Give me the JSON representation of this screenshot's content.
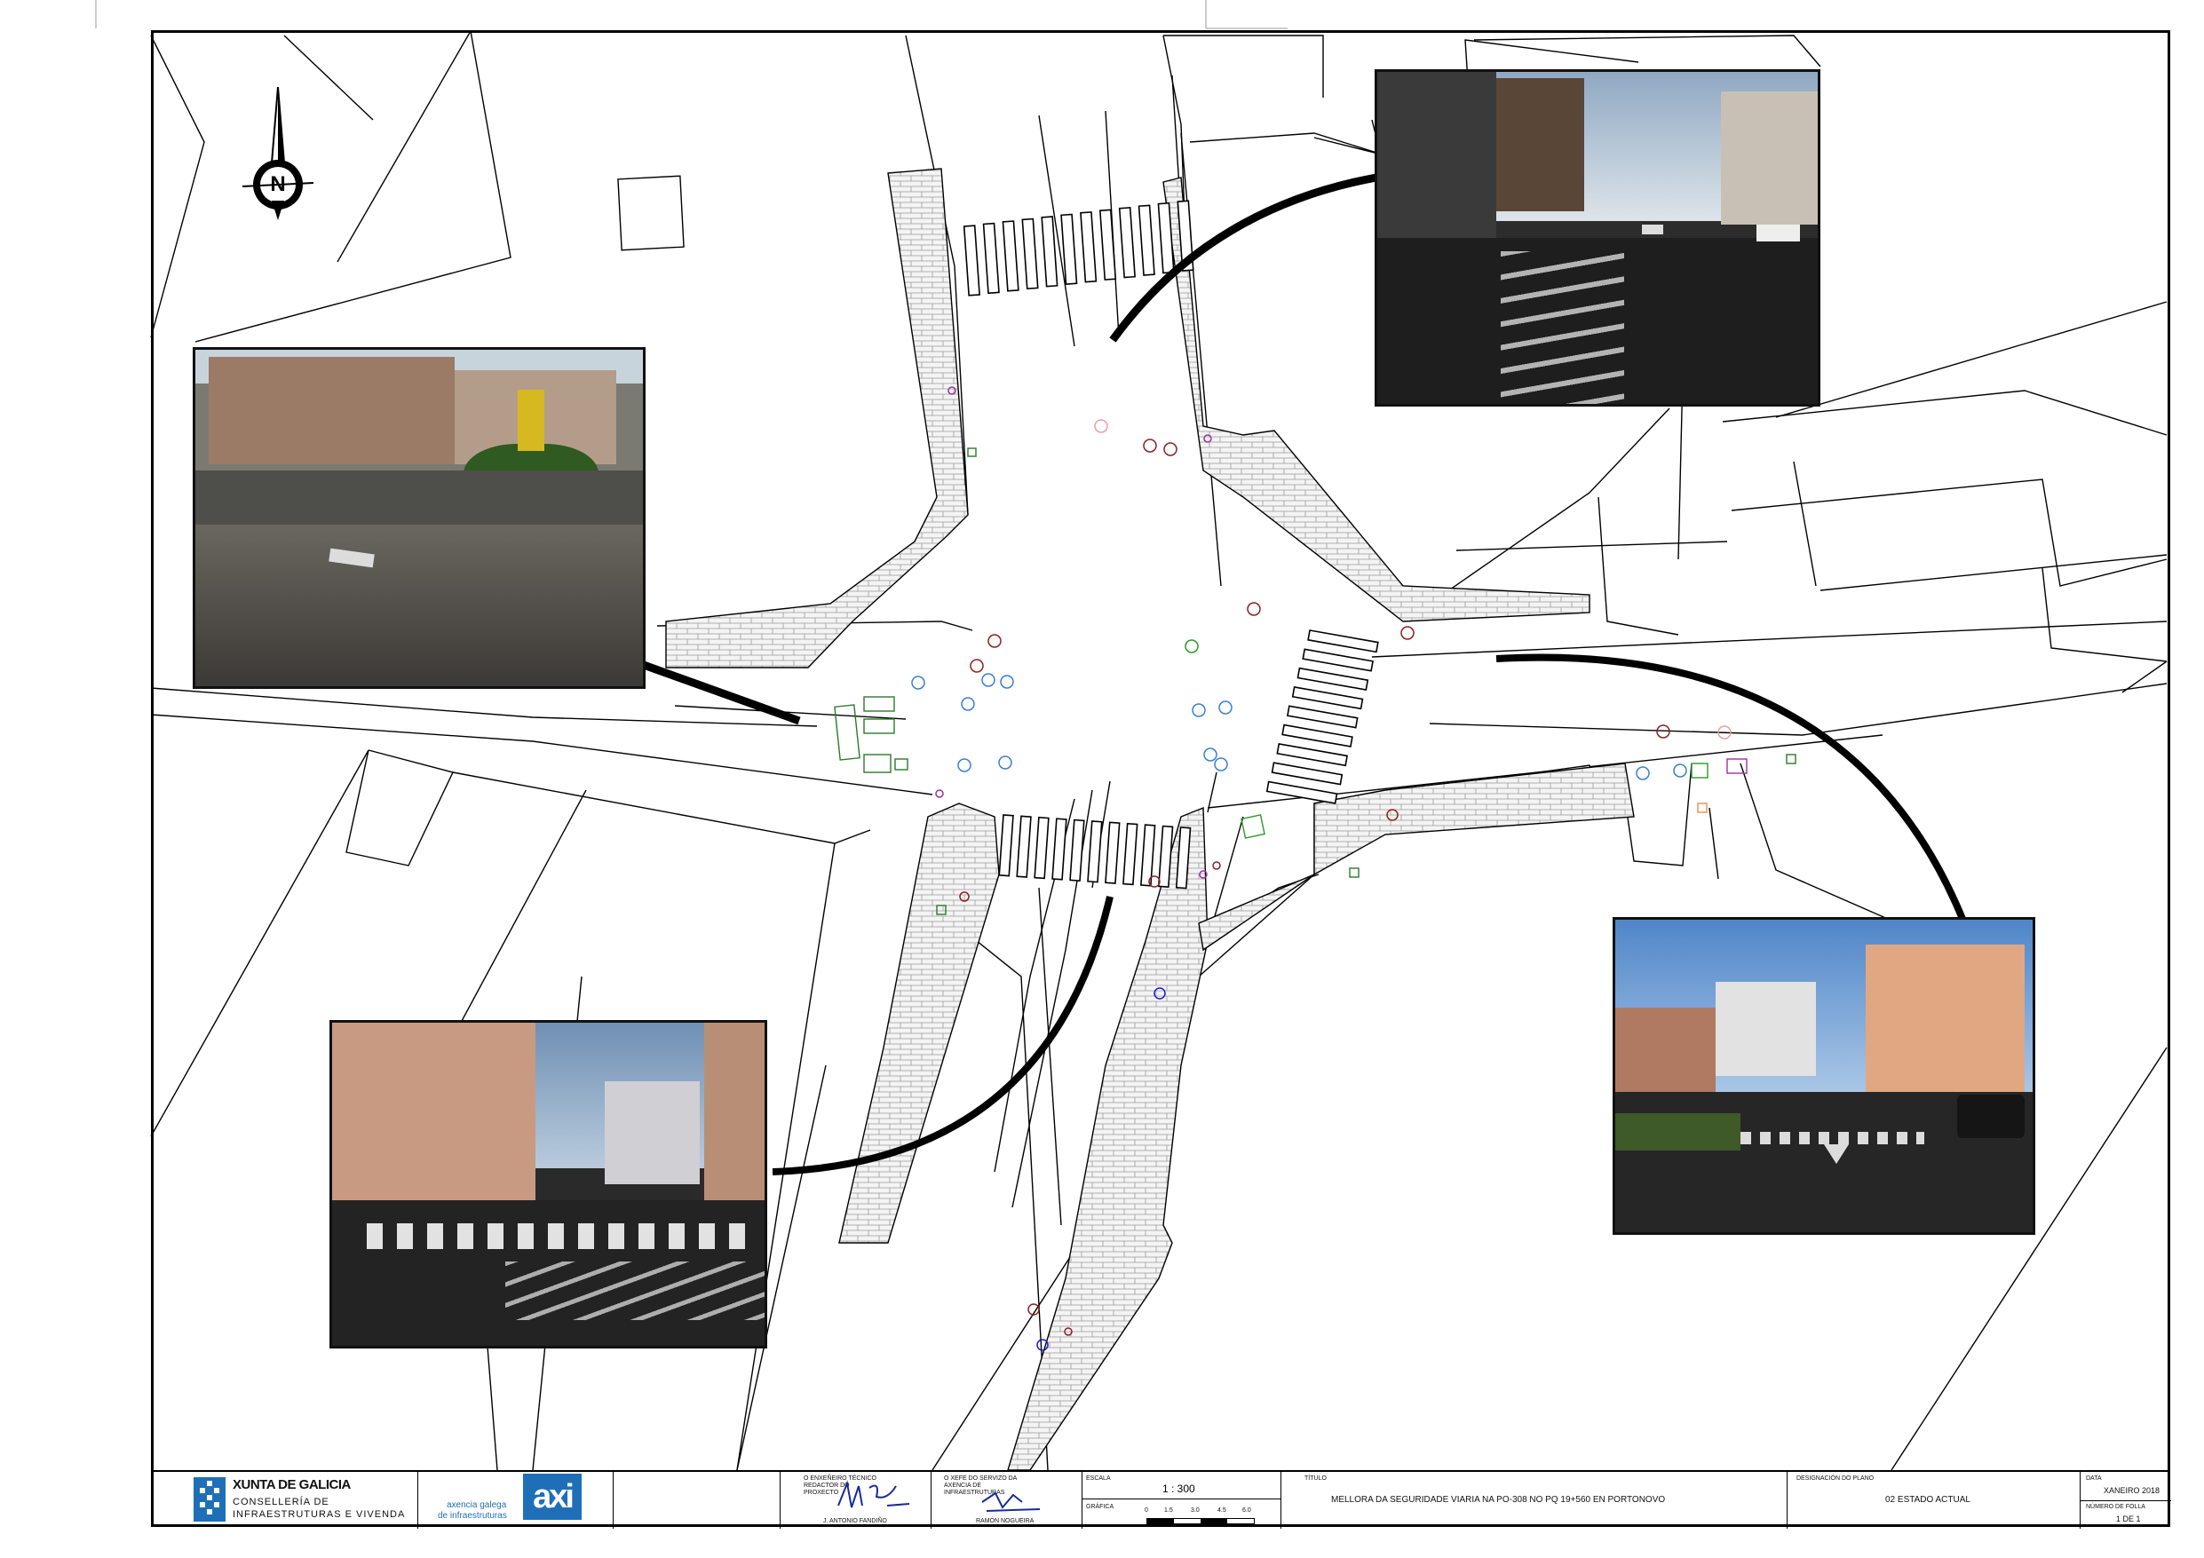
{
  "north_label": "N",
  "title_block": {
    "xunta_name": "XUNTA DE GALICIA",
    "consellaria_line1": "CONSELLERÍA DE",
    "consellaria_line2": "INFRAESTRUTURAS E VIVENDA",
    "axi_line1": "axencia galega",
    "axi_line2": "de infraestruturas",
    "axi_logo": "axi",
    "engineer_caption": "O ENXEÑEIRO TÉCNICO REDACTOR DO PROXECTO",
    "engineer_name": "J. ANTONIO FANDIÑO",
    "service_caption": "O XEFE DO SERVIZO DA AXENCIA DE INFRAESTRUTURAS",
    "service_name": "RAMÓN NOGUEIRA",
    "scale_caption": "ESCALA",
    "scale_value": "1 : 300",
    "graphic_caption": "GRÁFICA",
    "graphic_ticks": [
      "0",
      "1.5",
      "3.0",
      "4.5",
      "6.0"
    ],
    "project_caption": "TÍTULO",
    "project_title": "MELLORA DA SEGURIDADE VIARIA NA PO-308 NO PQ 19+560 EN PORTONOVO",
    "plan_caption": "DESIGNACIÓN DO PLANO",
    "plan_title": "02 ESTADO ACTUAL",
    "date_caption": "DATA",
    "date_value": "XANEIRO 2018",
    "sheet_caption": "NÚMERO DE FOLLA",
    "sheet_value": "1 DE 1"
  },
  "colors": {
    "ink": "#000000",
    "paving": "#8a8a8a",
    "marker_blue": "#3a7fd0",
    "marker_red": "#8b2020",
    "marker_green": "#2a9a2a",
    "marker_pink": "#e8a0a0",
    "marker_purple": "#a030a0",
    "marker_orange": "#e89040"
  },
  "photos": [
    {
      "id": "photo-top-right",
      "icon": "street-photo-northeast"
    },
    {
      "id": "photo-left",
      "icon": "street-photo-west"
    },
    {
      "id": "photo-bottom-left",
      "icon": "street-photo-south"
    },
    {
      "id": "photo-right",
      "icon": "street-photo-east"
    }
  ]
}
